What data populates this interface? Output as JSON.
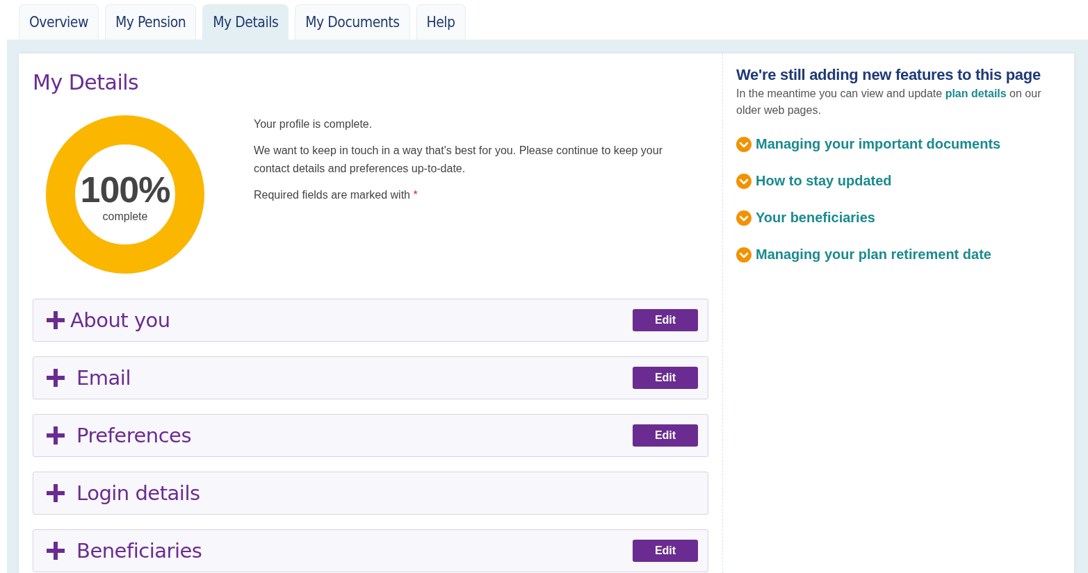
{
  "tabs": [
    {
      "label": "Overview",
      "selected": false
    },
    {
      "label": "My Pension",
      "selected": false
    },
    {
      "label": "My Details",
      "selected": true
    },
    {
      "label": "My Documents",
      "selected": false
    },
    {
      "label": "Help",
      "selected": false
    }
  ],
  "page_title": "My Details",
  "progress": {
    "level": 1,
    "value": "100%",
    "caption": "complete"
  },
  "intro": {
    "status": "Your profile is complete.",
    "message": "We want to keep in touch in a way that's best for you. Please continue to keep your contact details and preferences up-to-date.",
    "required_note": "Required fields are marked with",
    "required_mark": "*"
  },
  "sections": [
    {
      "title": "About you",
      "expanded": false,
      "edit_button": "Edit"
    },
    {
      "title": "Email",
      "expanded": false,
      "edit_button": "Edit"
    },
    {
      "title": "Preferences",
      "expanded": false,
      "edit_button": "Edit"
    },
    {
      "title": "Login details",
      "expanded": false
    },
    {
      "title": "Beneficiaries",
      "expanded": false,
      "edit_button": "Edit"
    }
  ],
  "sidebar": {
    "heading": "We're still adding new features to this page",
    "text_before": "In the meantime you can view and update",
    "link": "plan details",
    "text_after": "on our older web pages.",
    "links": [
      "Managing your important documents",
      "How to stay updated",
      "Your beneficiaries",
      "Managing your plan retirement date"
    ]
  }
}
